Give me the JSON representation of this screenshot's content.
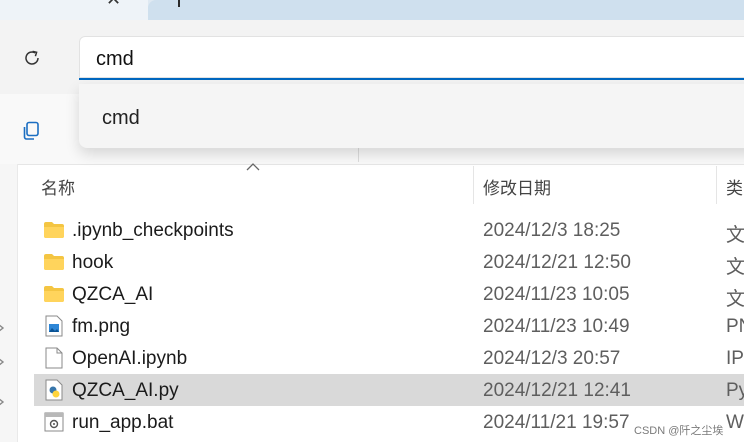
{
  "address_bar": {
    "value": "cmd"
  },
  "suggestions": [
    {
      "label": "cmd"
    }
  ],
  "columns": {
    "name": "名称",
    "modified": "修改日期",
    "type": "类"
  },
  "files": [
    {
      "name": ".ipynb_checkpoints",
      "modified": "2024/12/3 18:25",
      "type": "文",
      "icon": "folder-icon",
      "selected": false
    },
    {
      "name": "hook",
      "modified": "2024/12/21 12:50",
      "type": "文",
      "icon": "folder-icon",
      "selected": false
    },
    {
      "name": "QZCA_AI",
      "modified": "2024/11/23 10:05",
      "type": "文",
      "icon": "folder-icon",
      "selected": false
    },
    {
      "name": "fm.png",
      "modified": "2024/11/23 10:49",
      "type": "PN",
      "icon": "image-file-icon",
      "selected": false
    },
    {
      "name": "OpenAI.ipynb",
      "modified": "2024/12/3 20:57",
      "type": "IPY",
      "icon": "blank-file-icon",
      "selected": false
    },
    {
      "name": "QZCA_AI.py",
      "modified": "2024/12/21 12:41",
      "type": "Py",
      "icon": "python-file-icon",
      "selected": true
    },
    {
      "name": "run_app.bat",
      "modified": "2024/11/21 19:57",
      "type": "W",
      "icon": "batch-file-icon",
      "selected": false
    }
  ],
  "watermark": "CSDN @阡之尘埃",
  "colors": {
    "accent": "#0067c0",
    "folder": "#f4c542",
    "selected_row": "#d9d9d9"
  }
}
